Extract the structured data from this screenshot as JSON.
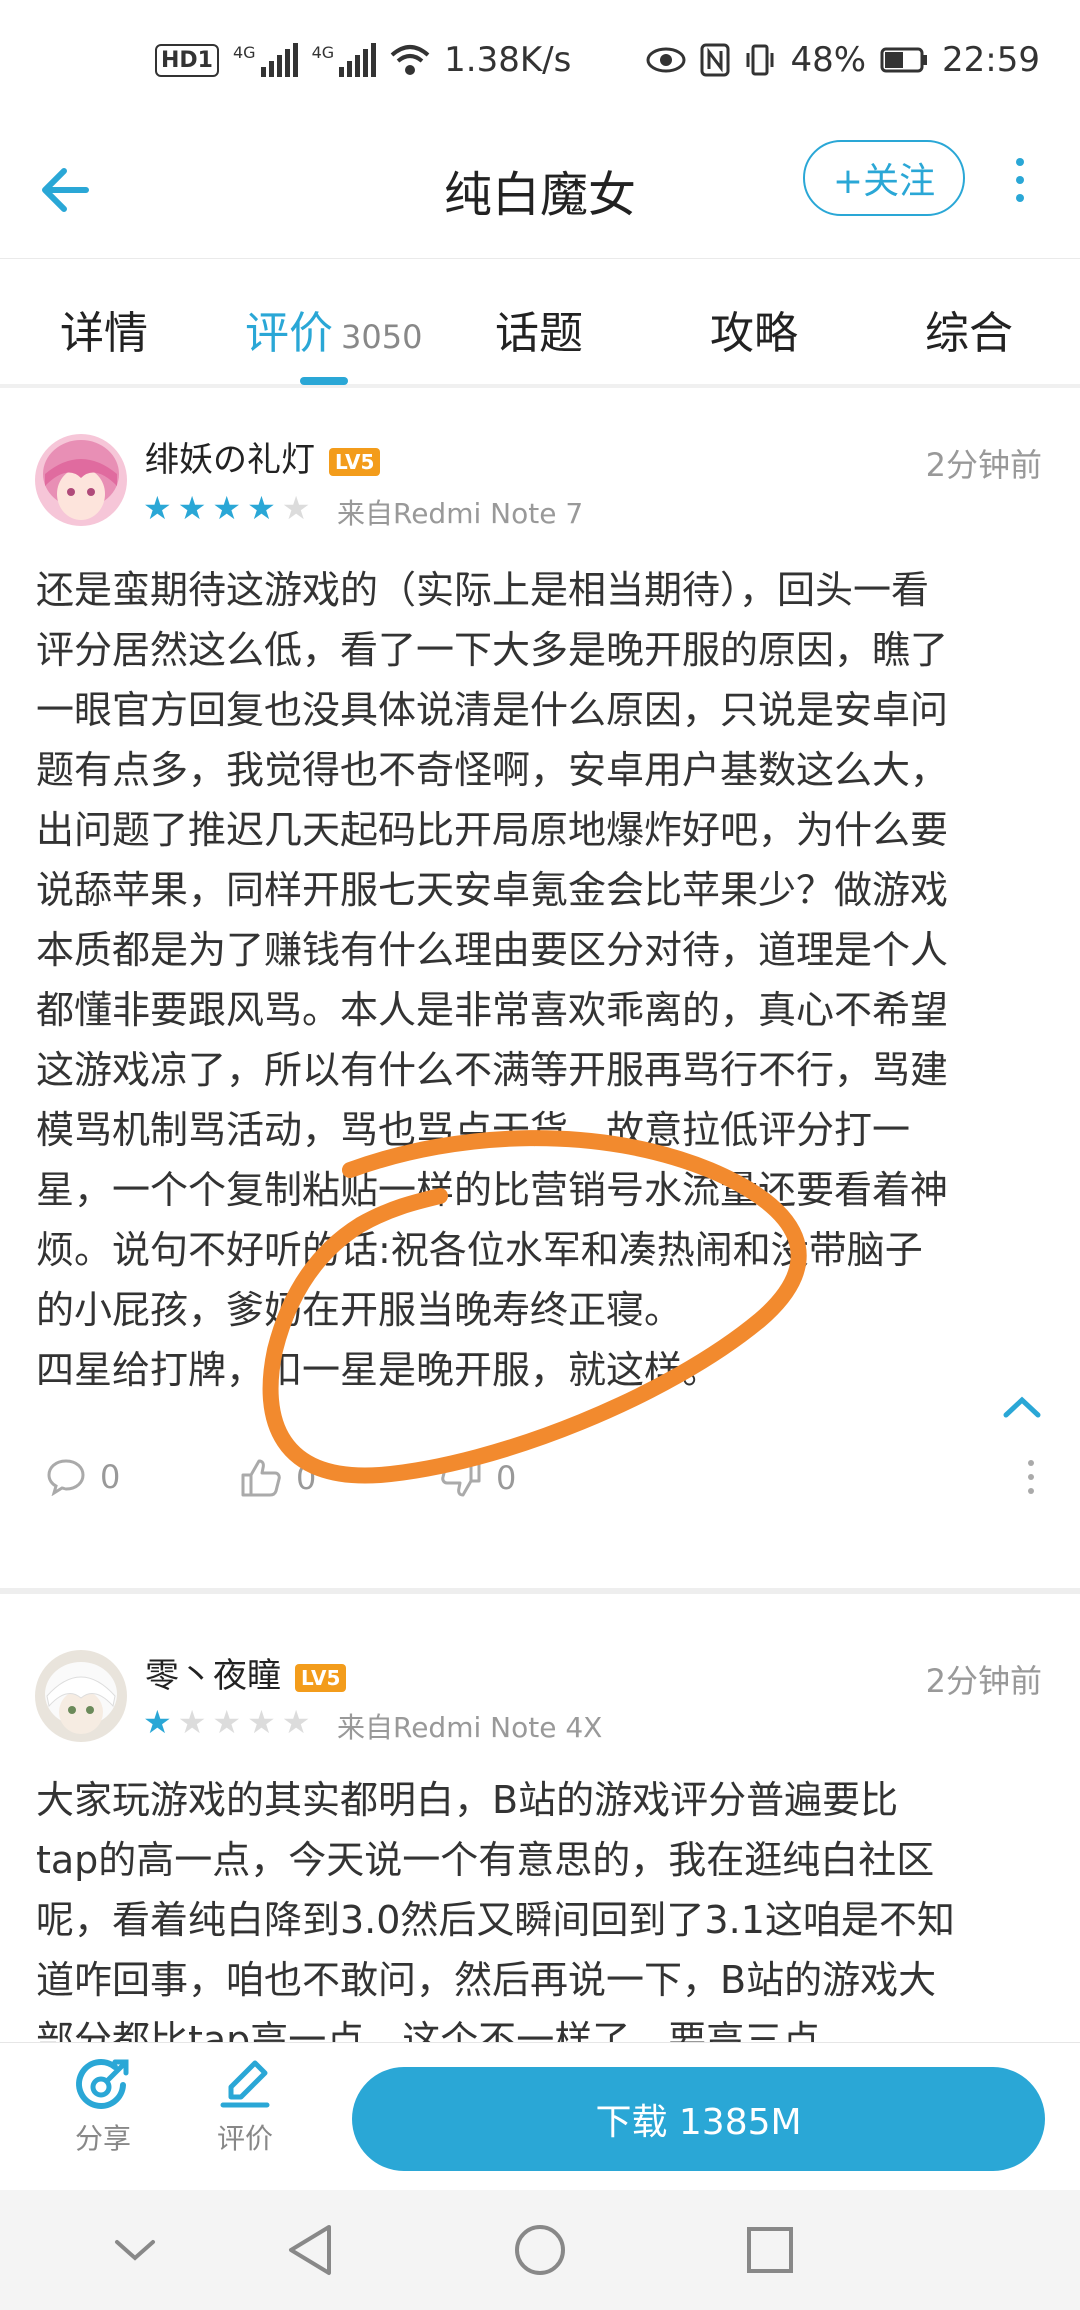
{
  "status_bar": {
    "hd": "HD1",
    "net1": "4G",
    "net2": "4G",
    "speed": "1.38K/s",
    "battery": "48%",
    "time": "22:59"
  },
  "header": {
    "title": "纯白魔女",
    "follow_label": "+关注"
  },
  "tabs": [
    {
      "label": "详情"
    },
    {
      "label": "评价",
      "count": "3050"
    },
    {
      "label": "话题"
    },
    {
      "label": "攻略"
    },
    {
      "label": "综合"
    }
  ],
  "reviews": [
    {
      "username": "绯妖の礼灯",
      "level": "LV5",
      "time": "2分钟前",
      "rating": 4,
      "device": "来自Redmi Note 7",
      "body": "还是蛮期待这游戏的（实际上是相当期待），回头一看\n评分居然这么低，看了一下大多是晚开服的原因，瞧了\n一眼官方回复也没具体说清是什么原因，只说是安卓问\n题有点多，我觉得也不奇怪啊，安卓用户基数这么大，\n出问题了推迟几天起码比开局原地爆炸好吧，为什么要\n说舔苹果，同样开服七天安卓氪金会比苹果少？做游戏\n本质都是为了赚钱有什么理由要区分对待，道理是个人\n都懂非要跟风骂。本人是非常喜欢乖离的，真心不希望\n这游戏凉了，所以有什么不满等开服再骂行不行，骂建\n模骂机制骂活动，骂也骂点干货，故意拉低评分打一\n星，一个个复制粘贴一样的比营销号水流量还要看着神\n烦。说句不好听的话:祝各位水军和凑热闹和没带脑子\n的小屁孩，爹妈在开服当晚寿终正寝。\n四星给打牌，扣一星是晚开服，就这样。",
      "comments": "0",
      "likes": "0",
      "dislikes": "0"
    },
    {
      "username": "零丶夜瞳",
      "level": "LV5",
      "time": "2分钟前",
      "rating": 1,
      "device": "来自Redmi Note 4X",
      "body": "大家玩游戏的其实都明白，B站的游戏评分普遍要比\ntap的高一点，今天说一个有意思的，我在逛纯白社区\n呢，看着纯白降到3.0然后又瞬间回到了3.1这咱是不知\n道咋回事，咱也不敢问，然后再说一下，B站的游戏大\n部分都比tap高一点，这个不一样了，要高三点"
    }
  ],
  "bottom_bar": {
    "share_label": "分享",
    "review_label": "评价",
    "download_label": "下载 1385M"
  },
  "colors": {
    "accent": "#2aa7d6",
    "annotation": "#f28a2e",
    "level_badge": "#f39c1b"
  }
}
